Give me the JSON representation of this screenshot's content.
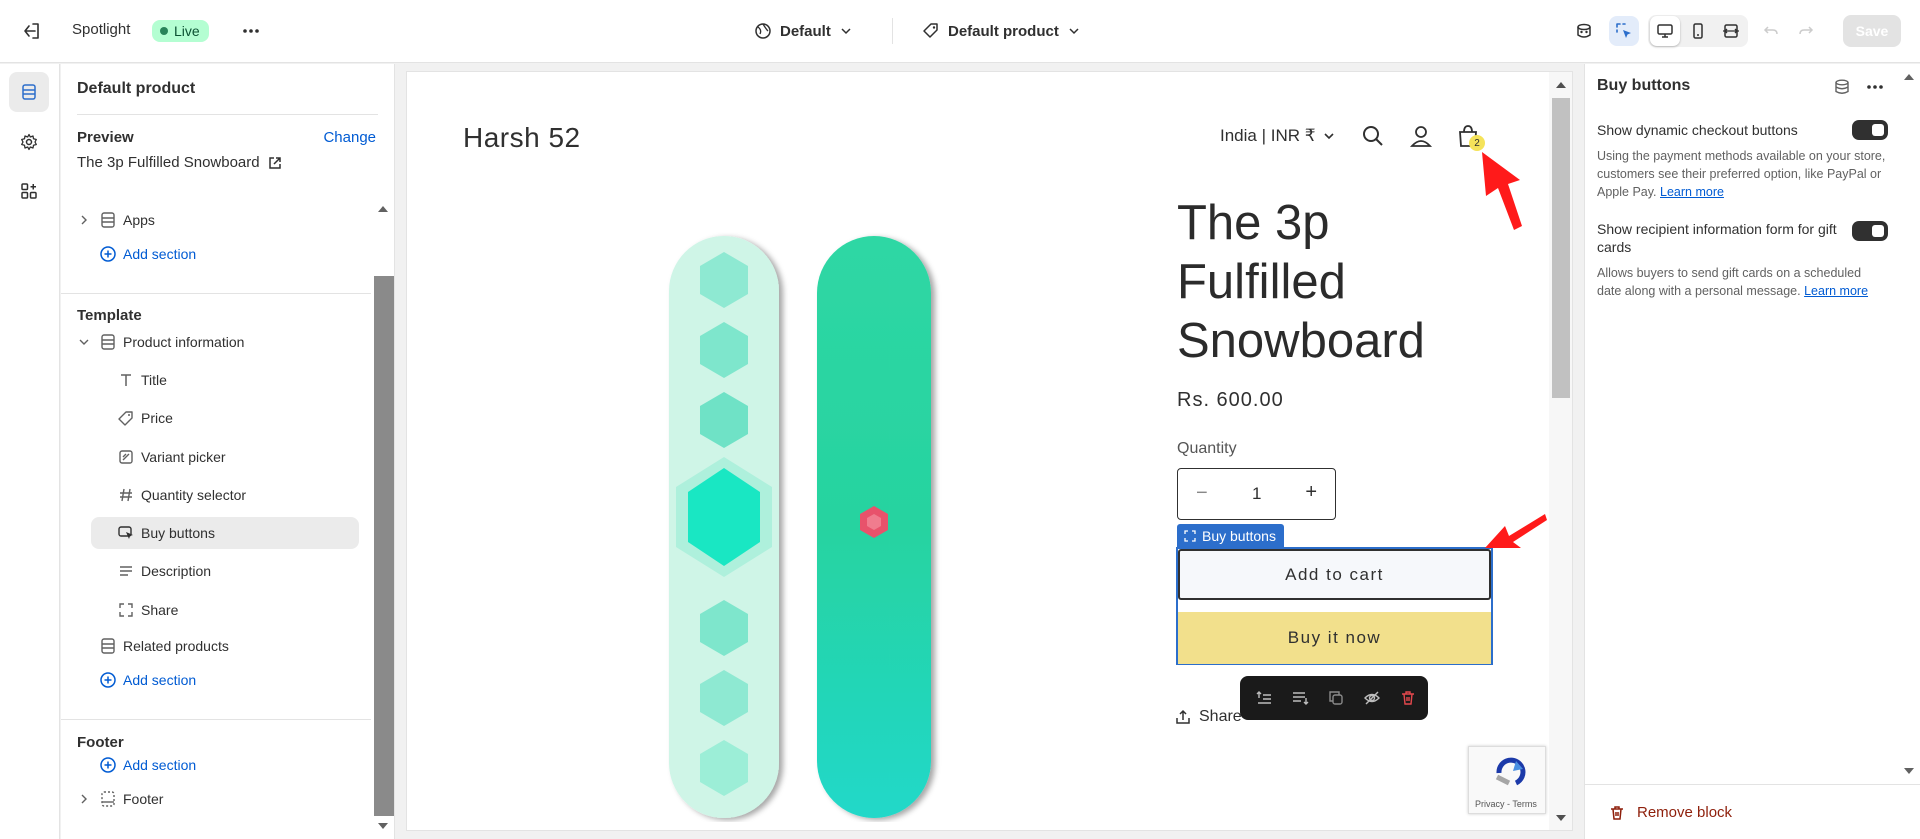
{
  "topbar": {
    "theme_name": "Spotlight",
    "status": "Live",
    "template": "Default",
    "page": "Default product",
    "save_label": "Save"
  },
  "left_panel": {
    "title": "Default product",
    "preview_label": "Preview",
    "change_label": "Change",
    "preview_product": "The 3p Fulfilled Snowboard",
    "header_group": {
      "apps_label": "Apps",
      "add_section": "Add section"
    },
    "template_heading": "Template",
    "template_items": {
      "section": "Product information",
      "blocks": [
        "Title",
        "Price",
        "Variant picker",
        "Quantity selector",
        "Buy buttons",
        "Description",
        "Share"
      ],
      "related": "Related products",
      "add_section": "Add section"
    },
    "footer_heading": "Footer",
    "footer_add_section": "Add section",
    "footer_section": "Footer"
  },
  "store": {
    "brand": "Harsh 52",
    "locale": "India | INR ₹",
    "cart_count": "2",
    "product_title": "The 3p Fulfilled Snowboard",
    "price": "Rs. 600.00",
    "quantity_label": "Quantity",
    "quantity_value": "1",
    "block_tag": "Buy buttons",
    "add_to_cart": "Add to cart",
    "buy_now": "Buy it now",
    "share": "Share",
    "recaptcha_text": "Privacy - Terms"
  },
  "right_panel": {
    "title": "Buy buttons",
    "settings": [
      {
        "label": "Show dynamic checkout buttons",
        "help": "Using the payment methods available on your store, customers see their preferred option, like PayPal or Apple Pay.",
        "link": "Learn more",
        "enabled": true
      },
      {
        "label": "Show recipient information form for gift cards",
        "help": "Allows buyers to send gift cards on a scheduled date along with a personal message.",
        "link": "Learn more",
        "enabled": true
      }
    ],
    "remove_block": "Remove block"
  },
  "colors": {
    "accent_blue": "#2c6ecb",
    "link_blue": "#005bd3",
    "live_badge": "#b4fed2",
    "buy_now_yellow": "#f2e08c",
    "danger": "#8e1f0b",
    "annotation_arrow": "#ff1a1a"
  },
  "icons": {
    "exit": "exit-icon",
    "more": "more-horizontal-icon",
    "globe": "globe-icon",
    "tag": "tag-icon",
    "inspect": "inspect-icon",
    "desktop": "desktop-icon",
    "mobile": "mobile-icon",
    "fullwidth": "full-width-icon",
    "undo": "undo-icon",
    "redo": "redo-icon",
    "sections": "sections-icon",
    "settings": "gear-icon",
    "apps": "apps-icon",
    "search": "search-icon",
    "account": "account-icon",
    "cart": "cart-icon",
    "trash": "trash-icon"
  }
}
